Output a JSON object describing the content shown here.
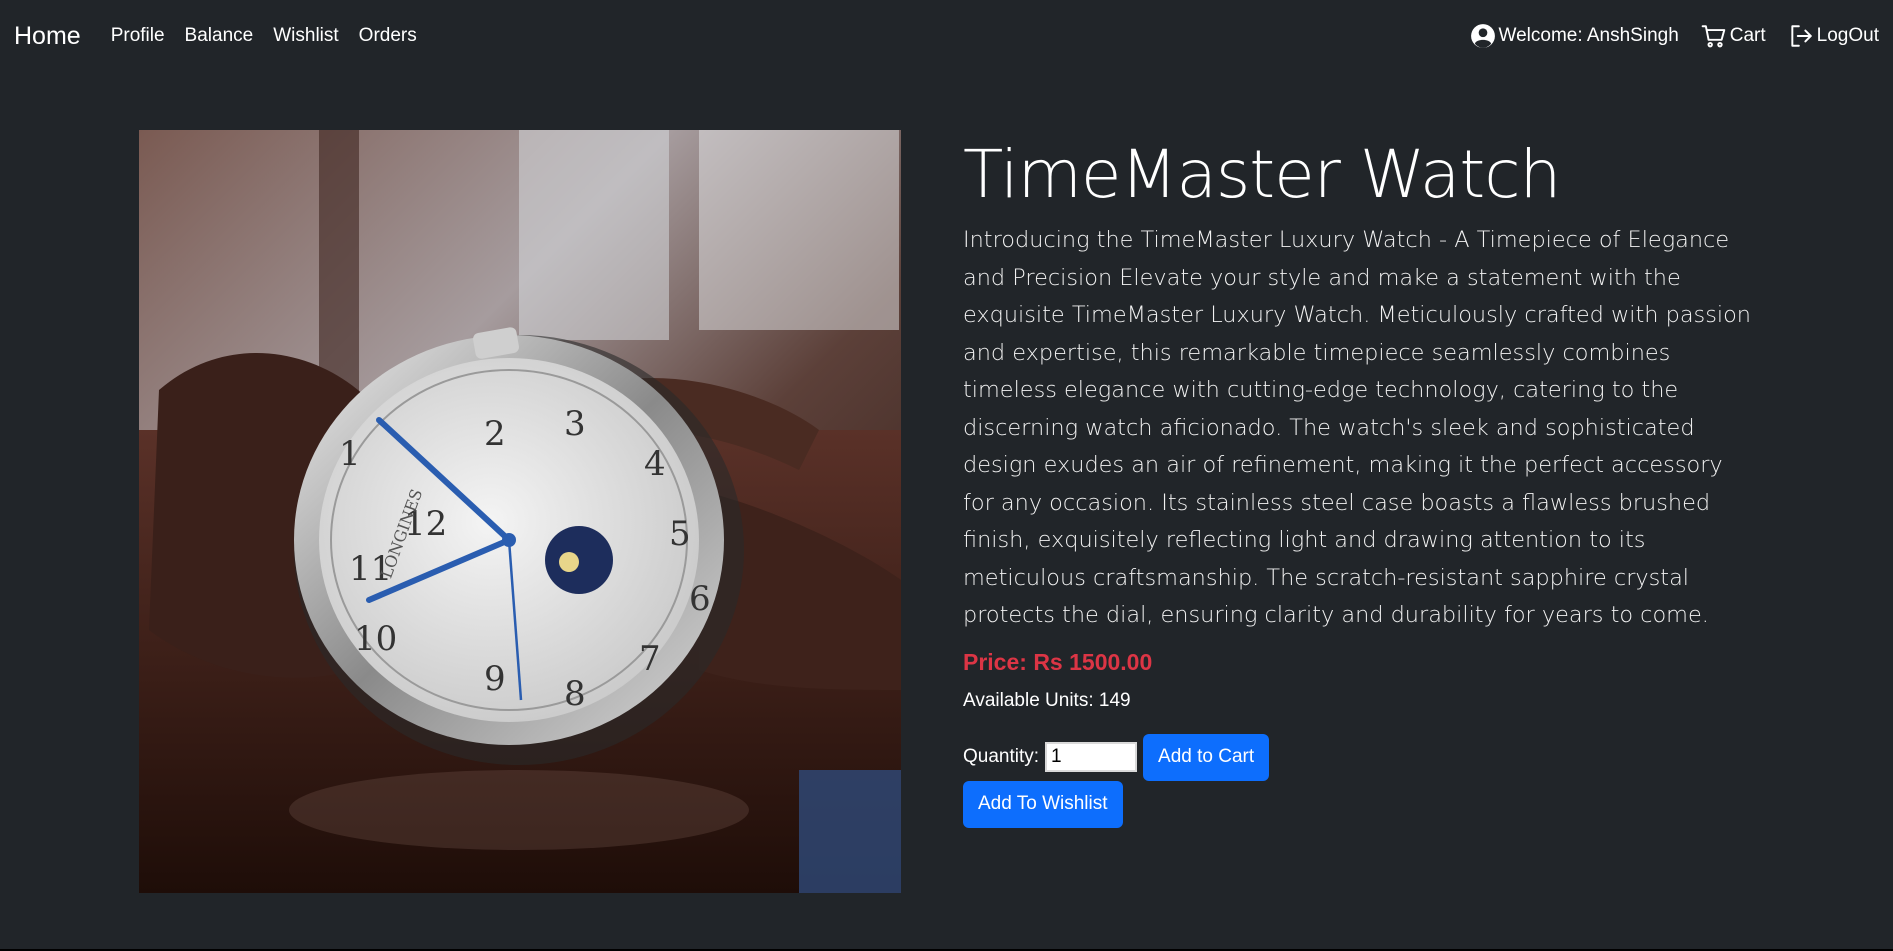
{
  "nav": {
    "brand": "Home",
    "links": [
      "Profile",
      "Balance",
      "Wishlist",
      "Orders"
    ],
    "welcome": "Welcome: AnshSingh",
    "cart": "Cart",
    "logout": "LogOut",
    "icons": {
      "welcome": "user-circle-icon",
      "cart": "cart-icon",
      "logout": "logout-icon"
    }
  },
  "product": {
    "title": "TimeMaster Watch",
    "description": "Introducing the TimeMaster Luxury Watch - A Timepiece of Elegance and Precision Elevate your style and make a statement with the exquisite TimeMaster Luxury Watch. Meticulously crafted with passion and expertise, this remarkable timepiece seamlessly combines timeless elegance with cutting-edge technology, catering to the discerning watch aficionado. The watch's sleek and sophisticated design exudes an air of refinement, making it the perfect accessory for any occasion. Its stainless steel case boasts a flawless brushed finish, exquisitely reflecting light and drawing attention to its meticulous craftsmanship. The scratch-resistant sapphire crystal protects the dial, ensuring clarity and durability for years to come.",
    "price": "Price: Rs 1500.00",
    "available": "Available Units: 149",
    "quantity_label": "Quantity:",
    "quantity_value": "1",
    "add_to_cart": "Add to Cart",
    "add_to_wishlist": "Add To Wishlist",
    "image_brand": "LONGINES"
  },
  "colors": {
    "background": "#212529",
    "primary": "#0d6efd",
    "price": "#dc3545"
  }
}
